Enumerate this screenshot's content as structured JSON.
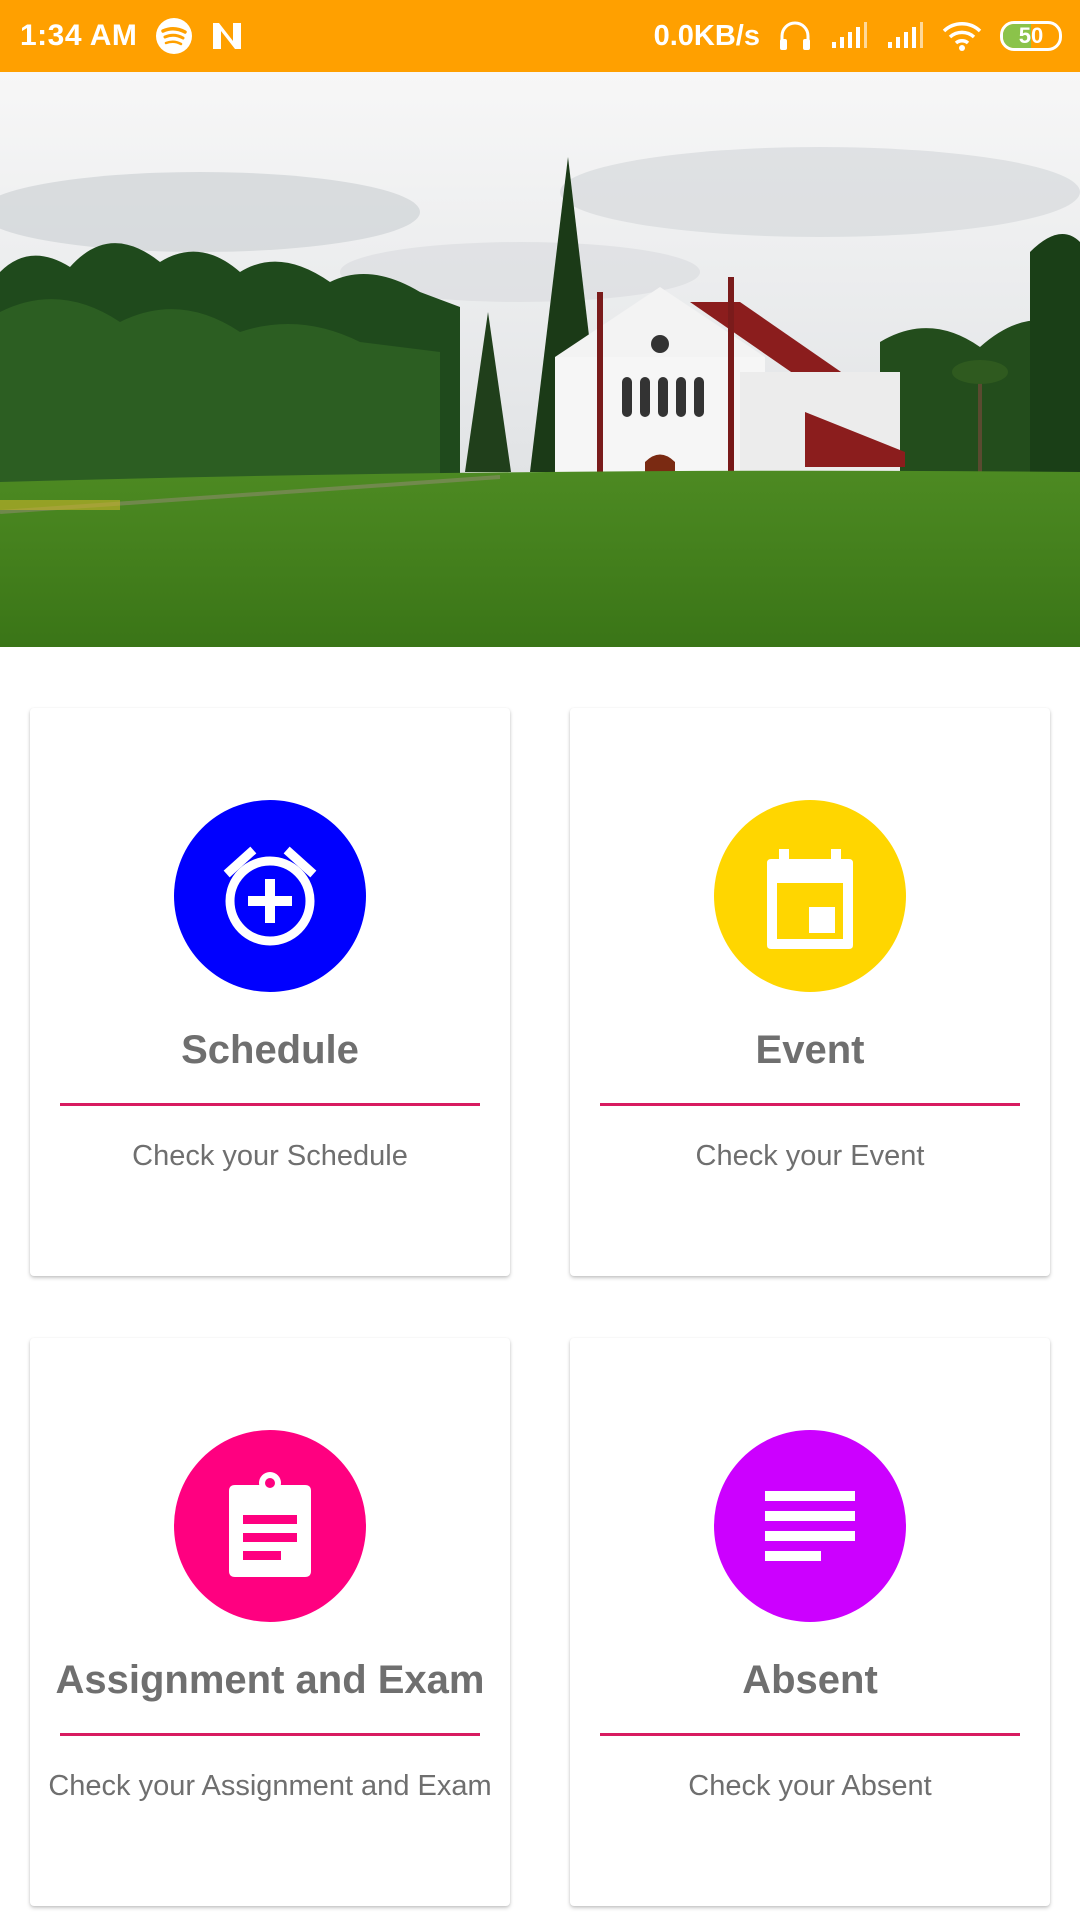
{
  "status_bar": {
    "time": "1:34 AM",
    "network_speed": "0.0KB/s",
    "battery_level": "50",
    "icons": [
      "spotify-icon",
      "n-app-icon",
      "headphones-icon",
      "signal-icon",
      "signal-icon",
      "wifi-icon",
      "battery-icon"
    ],
    "color": "#FFA000"
  },
  "hero": {
    "image": "campus-church-photo"
  },
  "menu": {
    "accent_color": "#D81B60",
    "items": [
      {
        "title": "Schedule",
        "description": "Check your Schedule",
        "icon": "alarm-add-icon",
        "color": "#0000FF"
      },
      {
        "title": "Event",
        "description": "Check your Event",
        "icon": "calendar-icon",
        "color": "#FFD600"
      },
      {
        "title": "Assignment and Exam",
        "description": "Check your Assignment and Exam",
        "icon": "clipboard-icon",
        "color": "#FF0080"
      },
      {
        "title": "Absent",
        "description": "Check your Absent",
        "icon": "notes-icon",
        "color": "#CC00FF"
      }
    ]
  }
}
